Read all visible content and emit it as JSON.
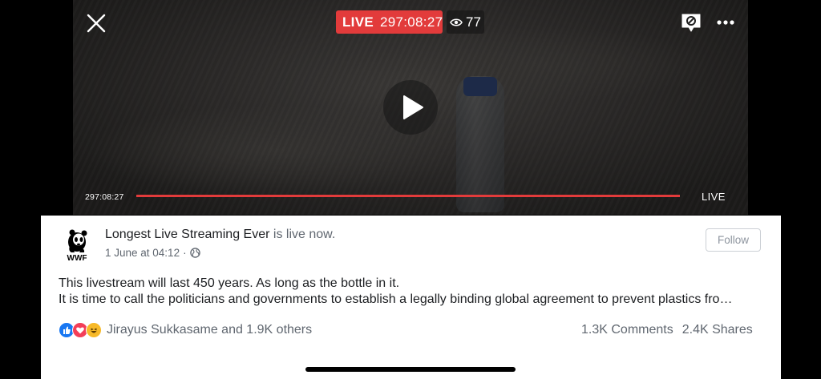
{
  "video": {
    "live_label": "LIVE",
    "live_duration": "297:08:27",
    "viewer_count": "77",
    "elapsed_time": "297:08:27",
    "progress_fraction": 1.0,
    "end_label": "LIVE"
  },
  "post": {
    "page_name": "Longest Live Streaming Ever",
    "status_suffix": " is live now.",
    "timestamp": "1 June at 04:12",
    "separator": "·",
    "follow_label": "Follow",
    "text_line1": "This livestream will last 450 years. As long as the bottle in it.",
    "text_line2": "It is time to call the politicians and governments to establish a legally binding global agreement to prevent plastics fro…",
    "avatar_text": "WWF",
    "reactors": "Jirayus Sukkasame and 1.9K others",
    "comments": "1.3K Comments",
    "shares": "2.4K Shares"
  },
  "icons": [
    "close-icon",
    "eye-icon",
    "comments-off-icon",
    "more-icon",
    "play-icon",
    "globe-icon",
    "like-icon",
    "love-icon",
    "haha-icon",
    "wwf-panda-logo"
  ],
  "colors": {
    "live_red": "#e23b3b",
    "like_blue": "#1877f2",
    "love_red": "#f33e58",
    "haha_yellow": "#f7b928"
  }
}
